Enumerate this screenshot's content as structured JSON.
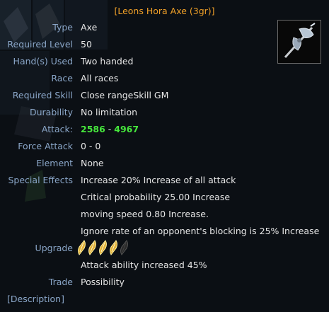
{
  "title": "[Leons Hora Axe (3gr)]",
  "icon": "axe-item-icon",
  "stats": {
    "type": {
      "label": "Type",
      "value": "Axe"
    },
    "required_level": {
      "label": "Required Level",
      "value": "50"
    },
    "hands_used": {
      "label": "Hand(s) Used",
      "value": "Two handed"
    },
    "race": {
      "label": "Race",
      "value": "All races"
    },
    "required_skill": {
      "label": "Required Skill",
      "value": "Close rangeSkill GM"
    },
    "durability": {
      "label": "Durability",
      "value": "No limitation"
    },
    "attack": {
      "label": "Attack:",
      "min": "2586",
      "separator": " - ",
      "max": "4967"
    },
    "force_attack": {
      "label": "Force Attack",
      "value": "0 - 0"
    },
    "element": {
      "label": "Element",
      "value": "None"
    },
    "special_effects": {
      "label": "Special Effects",
      "lines": [
        "Increase 20% Increase of all attack",
        "Critical probability 25.00 Increase",
        "moving speed 0.80 Increase.",
        "Ignore rate of an opponent's blocking is 25% Increase"
      ]
    },
    "upgrade": {
      "label": "Upgrade",
      "filled": 4,
      "total": 5,
      "icon": "upgrade-gem-icon"
    },
    "upgrade_effect": "Attack ability increased 45%",
    "trade": {
      "label": "Trade",
      "value": "Possibility"
    }
  },
  "description_link": "[Description]",
  "colors": {
    "title": "#f0a028",
    "label": "#8aa6c8",
    "value": "#e6e6e6",
    "attack": "#46e63c",
    "background": "#080b0f"
  }
}
